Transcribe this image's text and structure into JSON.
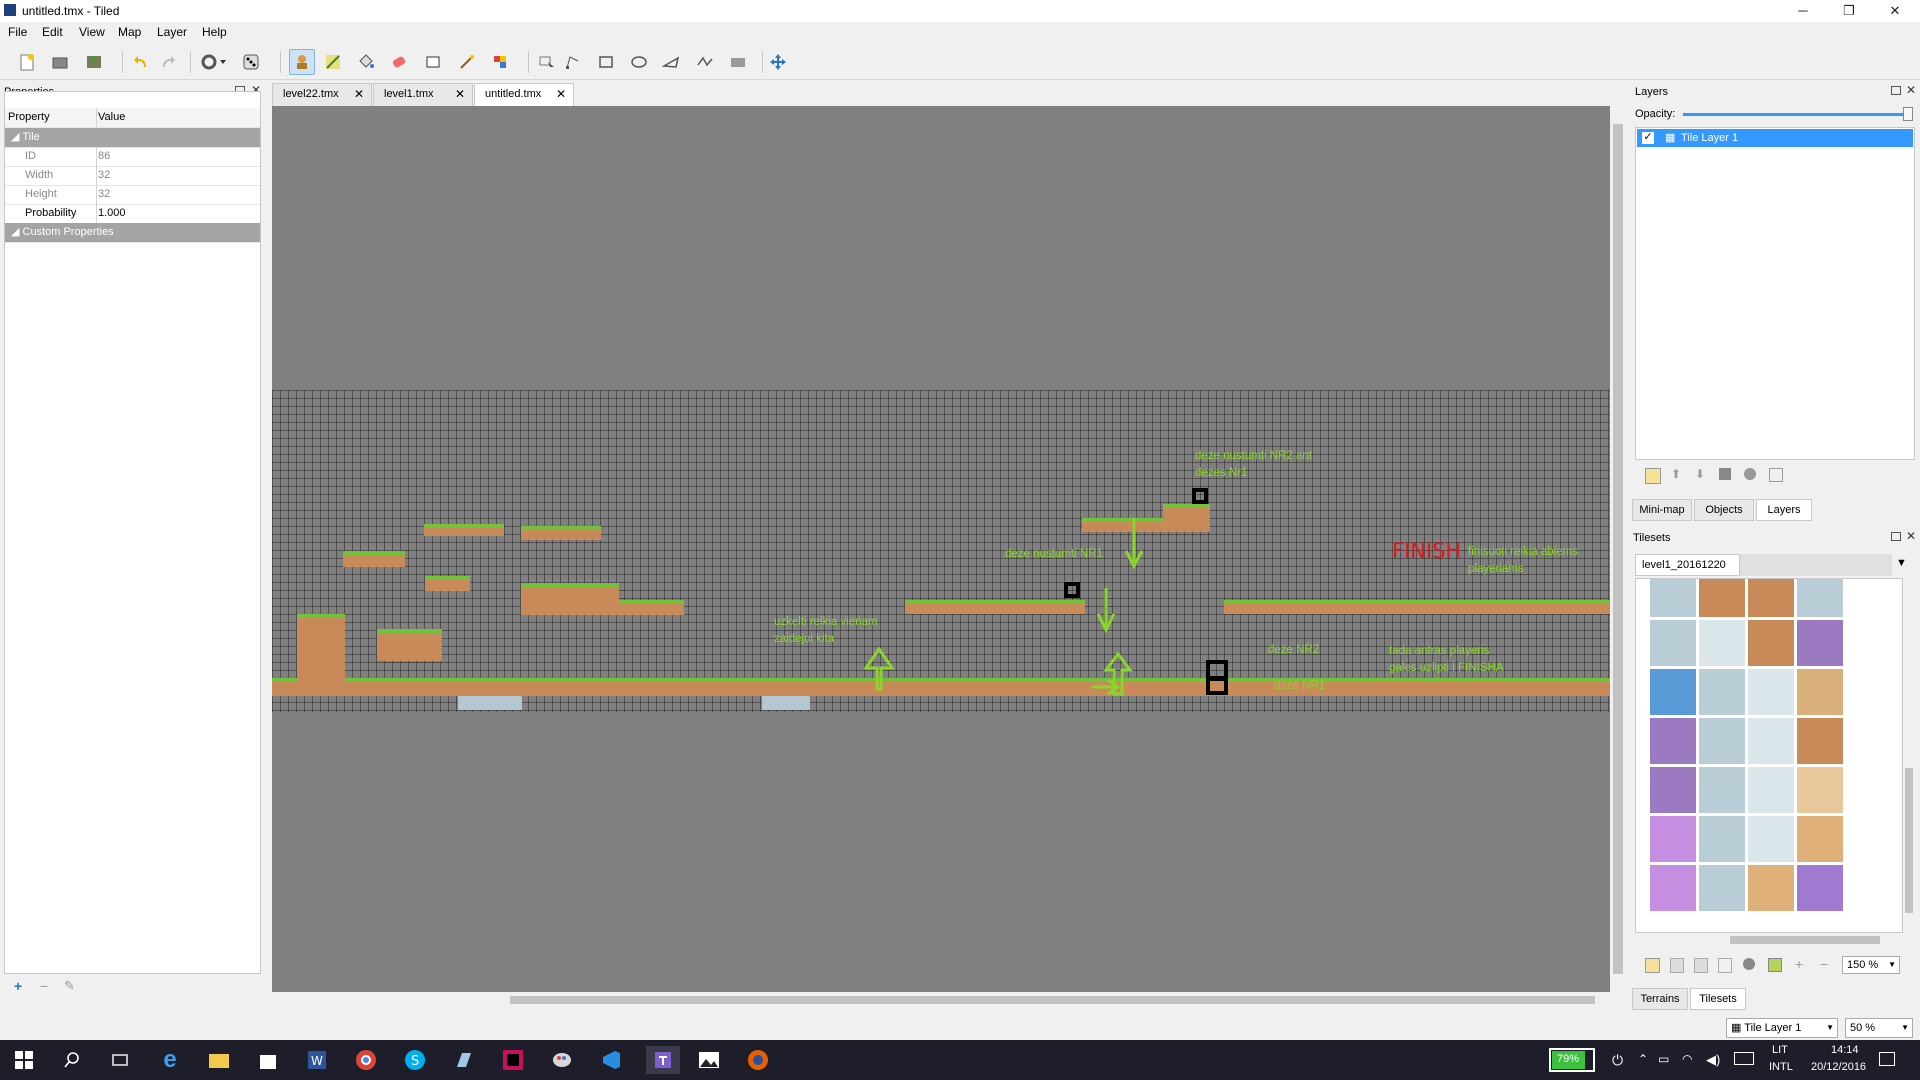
{
  "window": {
    "title": "untitled.tmx - Tiled",
    "minimize": "─",
    "restore": "❐",
    "close": "✕"
  },
  "menu": [
    "File",
    "Edit",
    "View",
    "Map",
    "Layer",
    "Help"
  ],
  "toolbar": [
    "new-icon",
    "open-icon",
    "save-icon",
    "undo-icon",
    "redo-icon",
    "commands-icon",
    "random-icon",
    "stamp-brush-icon",
    "terrain-brush-icon",
    "bucket-fill-icon",
    "eraser-icon",
    "rect-select-icon",
    "magic-wand-icon",
    "select-same-tile-icon",
    "select-objects-icon",
    "edit-polygons-icon",
    "insert-rect-icon",
    "insert-ellipse-icon",
    "insert-polygon-icon",
    "insert-polyline-icon",
    "insert-tile-icon",
    "move-icon"
  ],
  "properties": {
    "panel_title": "Properties",
    "col_property": "Property",
    "col_value": "Value",
    "group_tile": "Tile",
    "rows": [
      {
        "k": "ID",
        "v": "86"
      },
      {
        "k": "Width",
        "v": "32"
      },
      {
        "k": "Height",
        "v": "32"
      },
      {
        "k": "Probability",
        "v": "1.000"
      }
    ],
    "group_custom": "Custom Properties",
    "add": "+",
    "remove": "−",
    "edit": "✎"
  },
  "tabs": [
    {
      "label": "level22.tmx",
      "close": "✕"
    },
    {
      "label": "level1.tmx",
      "close": "✕"
    },
    {
      "label": "untitled.tmx",
      "close": "✕"
    }
  ],
  "map_notes": {
    "nr2": "deze nustumti NR2 ant\ndezes Nr1",
    "nr1": "deze nustumti NR1",
    "finish": "FINISH",
    "finish_note": "finisuoti reikia abiems\nplayeriams",
    "uzkelti": "uzkelti reikia vienam\nzaidejui kita",
    "deze_nr2": "deze NR2",
    "deze_nr1": "deze NR1",
    "tada": "tada antras playeris\ngales uzlipti i FINISHA"
  },
  "layers": {
    "panel_title": "Layers",
    "opacity_label": "Opacity:",
    "opacity": 1.0,
    "items": [
      {
        "name": "Tile Layer 1",
        "visible": true
      }
    ],
    "tabs": [
      "Mini-map",
      "Objects",
      "Layers"
    ]
  },
  "tilesets": {
    "panel_title": "Tilesets",
    "current": "level1_20161220",
    "zoom": "150 %",
    "tabs": [
      "Terrains",
      "Tilesets"
    ]
  },
  "status": {
    "layer": "Tile Layer 1",
    "zoom": "50 %"
  },
  "taskbar": {
    "battery": "79%",
    "lang": "LIT",
    "layout": "INTL",
    "time": "14:14",
    "date": "20/12/2016"
  },
  "colors": {
    "grass": "#74c13a",
    "dirt": "#c98a5a",
    "note": "#8ad42c",
    "finish": "#e01818",
    "selection": "#3399ff"
  }
}
